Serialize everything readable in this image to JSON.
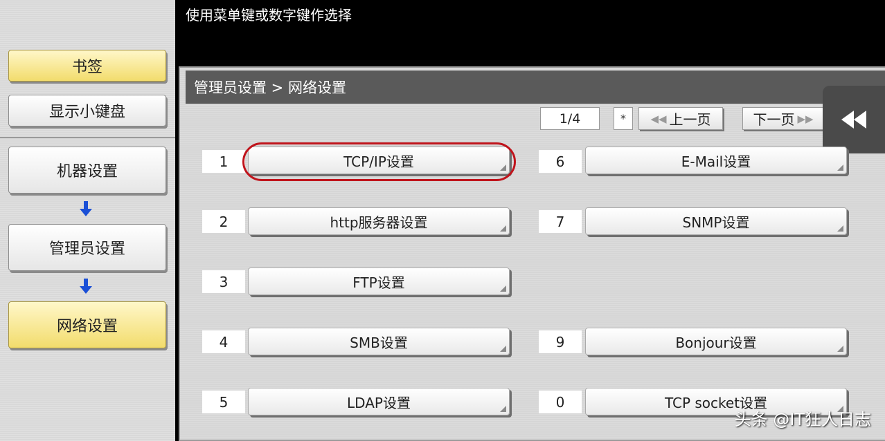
{
  "prompt_text": "使用菜单键或数字键作选择",
  "sidebar": {
    "bookmark_label": "书签",
    "show_keypad_label": "显示小键盘",
    "path": [
      {
        "label": "机器设置"
      },
      {
        "label": "管理员设置"
      },
      {
        "label": "网络设置"
      }
    ]
  },
  "breadcrumb": "管理员设置 > 网络设置",
  "pagination": {
    "indicator": "1/4",
    "star": "*",
    "prev_label": "上一页",
    "next_label": "下一页"
  },
  "menu_items": [
    {
      "number": "1",
      "label": "TCP/IP设置",
      "highlighted": true
    },
    {
      "number": "2",
      "label": "http服务器设置"
    },
    {
      "number": "3",
      "label": "FTP设置"
    },
    {
      "number": "4",
      "label": "SMB设置"
    },
    {
      "number": "5",
      "label": "LDAP设置"
    },
    {
      "number": "6",
      "label": "E-Mail设置"
    },
    {
      "number": "7",
      "label": "SNMP设置"
    },
    {
      "number": "9",
      "label": "Bonjour设置"
    },
    {
      "number": "0",
      "label": "TCP socket设置"
    }
  ],
  "watermark": "头条 @IT狂人日志",
  "colors": {
    "accent_yellow": "#f2dc6c",
    "highlight_red": "#c0141c",
    "arrow_blue": "#1a4fd6",
    "header_gray": "#5a5a5a"
  }
}
